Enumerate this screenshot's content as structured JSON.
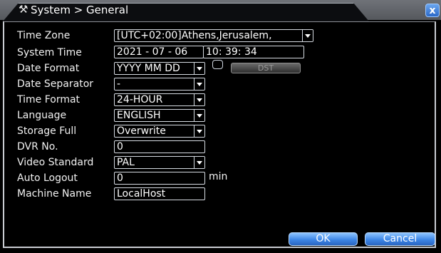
{
  "window": {
    "title": "System > General",
    "title_icon": "tools-icon",
    "close_label": "x"
  },
  "form": {
    "time_zone": {
      "label": "Time Zone",
      "value": "[UTC+02:00]Athens,Jerusalem,"
    },
    "system_time": {
      "label": "System Time",
      "date": "2021 - 07 - 06",
      "time": "10: 39: 34"
    },
    "date_format": {
      "label": "Date Format",
      "value": "YYYY MM DD",
      "dst_label": "DST",
      "dst_checked": false
    },
    "date_separator": {
      "label": "Date Separator",
      "value": "-"
    },
    "time_format": {
      "label": "Time Format",
      "value": "24-HOUR"
    },
    "language": {
      "label": "Language",
      "value": "ENGLISH"
    },
    "storage_full": {
      "label": "Storage Full",
      "value": "Overwrite"
    },
    "dvr_no": {
      "label": "DVR No.",
      "value": "0"
    },
    "video_standard": {
      "label": "Video Standard",
      "value": "PAL"
    },
    "auto_logout": {
      "label": "Auto Logout",
      "value": "0",
      "unit": "min"
    },
    "machine_name": {
      "label": "Machine Name",
      "value": "LocalHost"
    }
  },
  "buttons": {
    "ok": "OK",
    "cancel": "Cancel"
  },
  "colors": {
    "accent": "#3d86e6",
    "background": "#000000",
    "titlebar": "#5f6267"
  }
}
